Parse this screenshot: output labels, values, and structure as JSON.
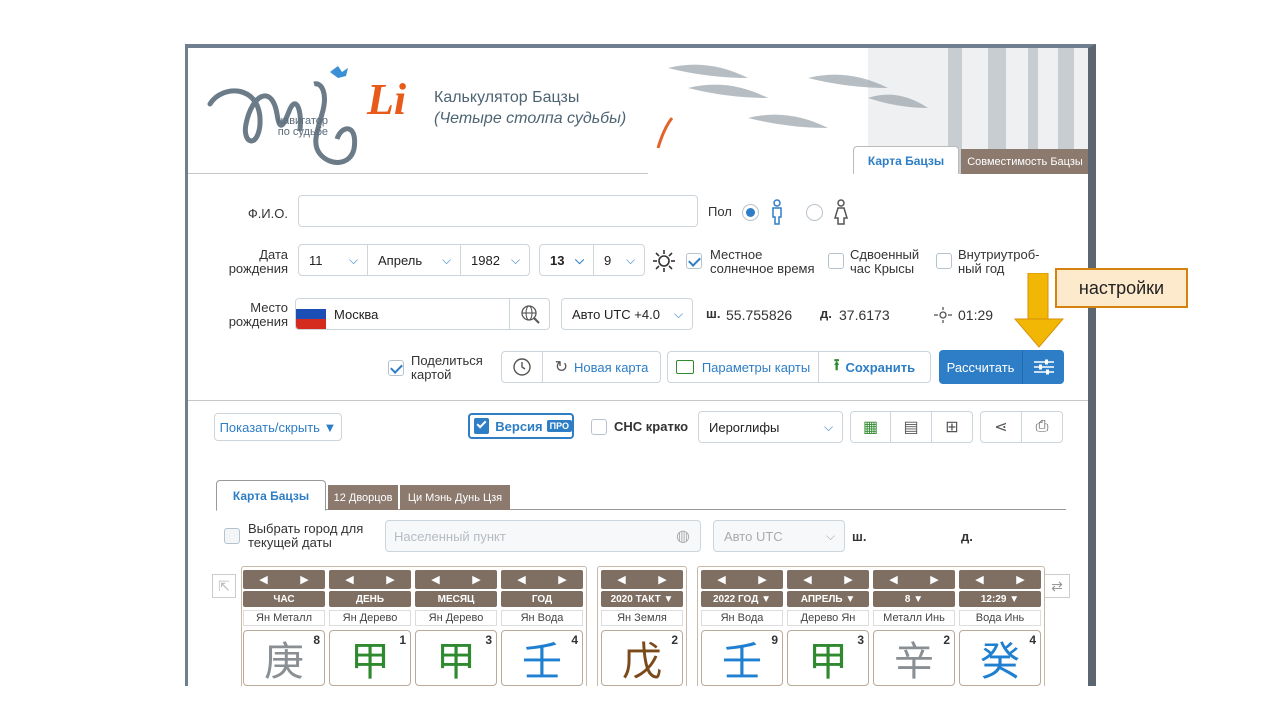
{
  "header": {
    "logo_subtext_1": "навигатор",
    "logo_subtext_2": "по судьбе",
    "title": "Калькулятор Бацзы",
    "subtitle": "(Четыре столпа судьбы)",
    "tabs": [
      "Карта Бацзы",
      "Совместимость Бацзы"
    ]
  },
  "form": {
    "fio_label": "Ф.И.О.",
    "fio_value": "",
    "gender_label": "Пол",
    "birth_date_label_1": "Дата",
    "birth_date_label_2": "рождения",
    "day": "11",
    "month": "Апрель",
    "year": "1982",
    "hour": "13",
    "minute": "9",
    "local_solar_time": [
      "Местное",
      "солнечное время"
    ],
    "double_rat_hour": [
      "Сдвоенный",
      "час Крысы"
    ],
    "intrauterine_year": [
      "Внутриутроб-",
      "ный год"
    ],
    "birthplace_label_1": "Место",
    "birthplace_label_2": "рождения",
    "city": "Москва",
    "utc": "Авто UTC +4.0",
    "lat_label": "ш.",
    "lat": "55.755826",
    "lon_label": "д.",
    "lon": "37.6173",
    "time_value": "01:29",
    "share_label_1": "Поделиться",
    "share_label_2": "картой",
    "new_map": "Новая карта",
    "map_params": "Параметры карты",
    "save": "Сохранить",
    "calculate": "Рассчитать"
  },
  "callout": {
    "text": "настройки"
  },
  "toolbar": {
    "show_hide": "Показать/скрыть ▼",
    "version": "Версия",
    "version_badge": "ПРО",
    "chs_short": "СНС кратко",
    "display_mode": "Иероглифы"
  },
  "subtabs": [
    "Карта Бацзы",
    "12 Дворцов",
    "Ци Мэнь Дунь Цзя"
  ],
  "location_row": {
    "checkbox_label_1": "Выбрать город для",
    "checkbox_label_2": "текущей даты",
    "placeholder": "Населенный пункт",
    "utc": "Авто UTC",
    "lat_label": "ш.",
    "lon_label": "д."
  },
  "pillars_natal": [
    {
      "label": "ЧАС",
      "sub": "Ян Металл",
      "glyph": "庚",
      "num": "8",
      "color": "#8a8f94"
    },
    {
      "label": "ДЕНЬ",
      "sub": "Ян Дерево",
      "glyph": "甲",
      "num": "1",
      "color": "#2f8a2f"
    },
    {
      "label": "МЕСЯЦ",
      "sub": "Ян Дерево",
      "glyph": "甲",
      "num": "3",
      "color": "#2f8a2f"
    },
    {
      "label": "ГОД",
      "sub": "Ян Вода",
      "glyph": "壬",
      "num": "4",
      "color": "#1f7fd1"
    }
  ],
  "pillar_luck": {
    "label": "2020 ТАКТ ▼",
    "sub": "Ян Земля",
    "glyph": "戊",
    "num": "2",
    "color": "#7a4a1a"
  },
  "pillars_current": [
    {
      "label": "2022 ГОД ▼",
      "sub": "Ян Вода",
      "glyph": "壬",
      "num": "9",
      "color": "#1f7fd1"
    },
    {
      "label": "АПРЕЛЬ ▼",
      "sub": "Дерево Ян",
      "glyph": "甲",
      "num": "3",
      "color": "#2f8a2f"
    },
    {
      "label": "8 ▼",
      "sub": "Металл Инь",
      "glyph": "辛",
      "num": "2",
      "color": "#8a8f94"
    },
    {
      "label": "12:29 ▼",
      "sub": "Вода Инь",
      "glyph": "癸",
      "num": "4",
      "color": "#1f7fd1"
    }
  ]
}
